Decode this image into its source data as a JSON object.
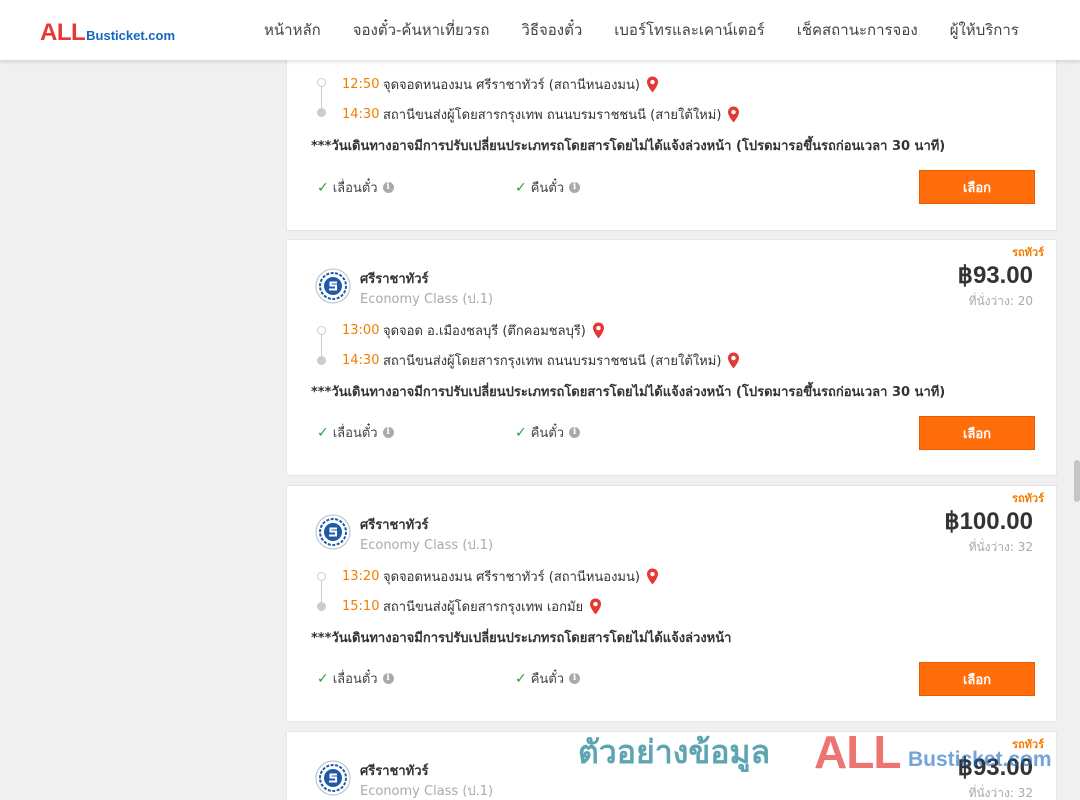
{
  "header": {
    "logo_all": "ALL",
    "logo_rest": "Busticket.com",
    "nav": [
      "หน้าหลัก",
      "จองตั๋ว-ค้นหาเที่ยวรถ",
      "วิธีจองตั๋ว",
      "เบอร์โทรและเคาน์เตอร์",
      "เช็คสถานะการจอง",
      "ผู้ให้บริการ"
    ]
  },
  "cards": [
    {
      "bus_tag": "",
      "operator": "",
      "class": "",
      "price": "",
      "seats": "",
      "depart_time": "12:50",
      "depart_place": "จุดจอดหนองมน ศรีราชาทัวร์ (สถานีหนองมน)",
      "arrive_time": "14:30",
      "arrive_place": "สถานีขนส่งผู้โดยสารกรุงเทพ ถนนบรมราชชนนี (สายใต้ใหม่)",
      "notice": "***วันเดินทางอาจมีการปรับเปลี่ยนประเภทรถโดยสารโดยไม่ได้แจ้งล่วงหน้า (โปรดมารอขึ้นรถก่อนเวลา 30 นาที)",
      "option_change": "เลื่อนตั๋ว",
      "option_refund": "คืนตั๋ว",
      "select_label": "เลือก"
    },
    {
      "bus_tag": "รถทัวร์",
      "operator": "ศรีราชาทัวร์",
      "class": "Economy Class (ป.1)",
      "price": "฿93.00",
      "seats": "ที่นั่งว่าง: 20",
      "depart_time": "13:00",
      "depart_place": "จุดจอด อ.เมืองชลบุรี (ตึกคอมชลบุรี)",
      "arrive_time": "14:30",
      "arrive_place": "สถานีขนส่งผู้โดยสารกรุงเทพ ถนนบรมราชชนนี (สายใต้ใหม่)",
      "notice": "***วันเดินทางอาจมีการปรับเปลี่ยนประเภทรถโดยสารโดยไม่ได้แจ้งล่วงหน้า (โปรดมารอขึ้นรถก่อนเวลา 30 นาที)",
      "option_change": "เลื่อนตั๋ว",
      "option_refund": "คืนตั๋ว",
      "select_label": "เลือก"
    },
    {
      "bus_tag": "รถทัวร์",
      "operator": "ศรีราชาทัวร์",
      "class": "Economy Class (ป.1)",
      "price": "฿100.00",
      "seats": "ที่นั่งว่าง: 32",
      "depart_time": "13:20",
      "depart_place": "จุดจอดหนองมน ศรีราชาทัวร์ (สถานีหนองมน)",
      "arrive_time": "15:10",
      "arrive_place": "สถานีขนส่งผู้โดยสารกรุงเทพ เอกมัย",
      "notice": "***วันเดินทางอาจมีการปรับเปลี่ยนประเภทรถโดยสารโดยไม่ได้แจ้งล่วงหน้า",
      "option_change": "เลื่อนตั๋ว",
      "option_refund": "คืนตั๋ว",
      "select_label": "เลือก"
    },
    {
      "bus_tag": "รถทัวร์",
      "operator": "ศรีราชาทัวร์",
      "class": "Economy Class (ป.1)",
      "price": "฿93.00",
      "seats": "ที่นั่งว่าง: 32"
    }
  ],
  "watermark": {
    "text": "ตัวอย่างข้อมูล",
    "all": "ALL",
    "rest": "Busticket.com"
  },
  "colors": {
    "accent_orange": "#ff6e0a",
    "time_orange": "#f57c00",
    "pin_red": "#e53935",
    "check_green": "#2e9e3e"
  }
}
